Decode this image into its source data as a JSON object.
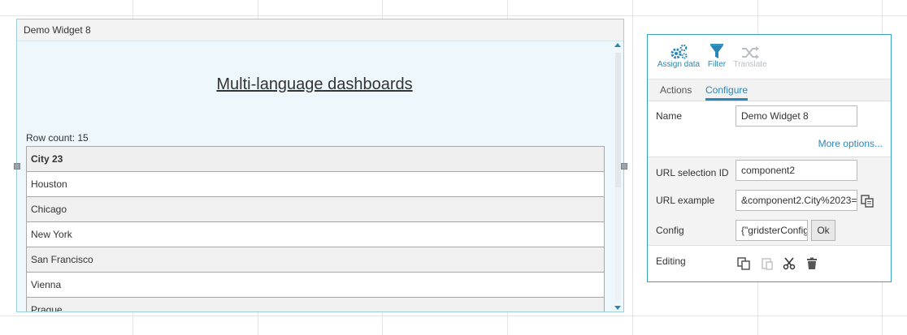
{
  "widget": {
    "title": "Demo Widget 8",
    "heading": "Multi-language dashboards",
    "row_count": "Row count: 15",
    "table": {
      "header": "City 23",
      "rows": [
        "Houston",
        "Chicago",
        "New York",
        "San Francisco",
        "Vienna",
        "Prague"
      ]
    }
  },
  "panel": {
    "toolbar": {
      "assign_data": "Assign data",
      "filter": "Filter",
      "translate": "Translate"
    },
    "tabs": {
      "actions": "Actions",
      "configure": "Configure"
    },
    "fields": {
      "name_label": "Name",
      "name_value": "Demo Widget 8",
      "more_options": "More options...",
      "url_sel_label": "URL selection ID",
      "url_sel_value": "component2",
      "url_example_label": "URL example",
      "url_example_value": "&component2.City%2023=",
      "config_label": "Config",
      "config_value": "{\"gridsterConfig\"",
      "ok_label": "Ok",
      "editing_label": "Editing"
    }
  },
  "colors": {
    "accent": "#2a86b5",
    "widget_bg": "#eef8fc",
    "panel_border": "#3aa1c2"
  },
  "icons": [
    "gears-icon",
    "filter-icon",
    "shuffle-icon",
    "copy-icon",
    "paste-icon",
    "cut-icon",
    "trash-icon"
  ]
}
